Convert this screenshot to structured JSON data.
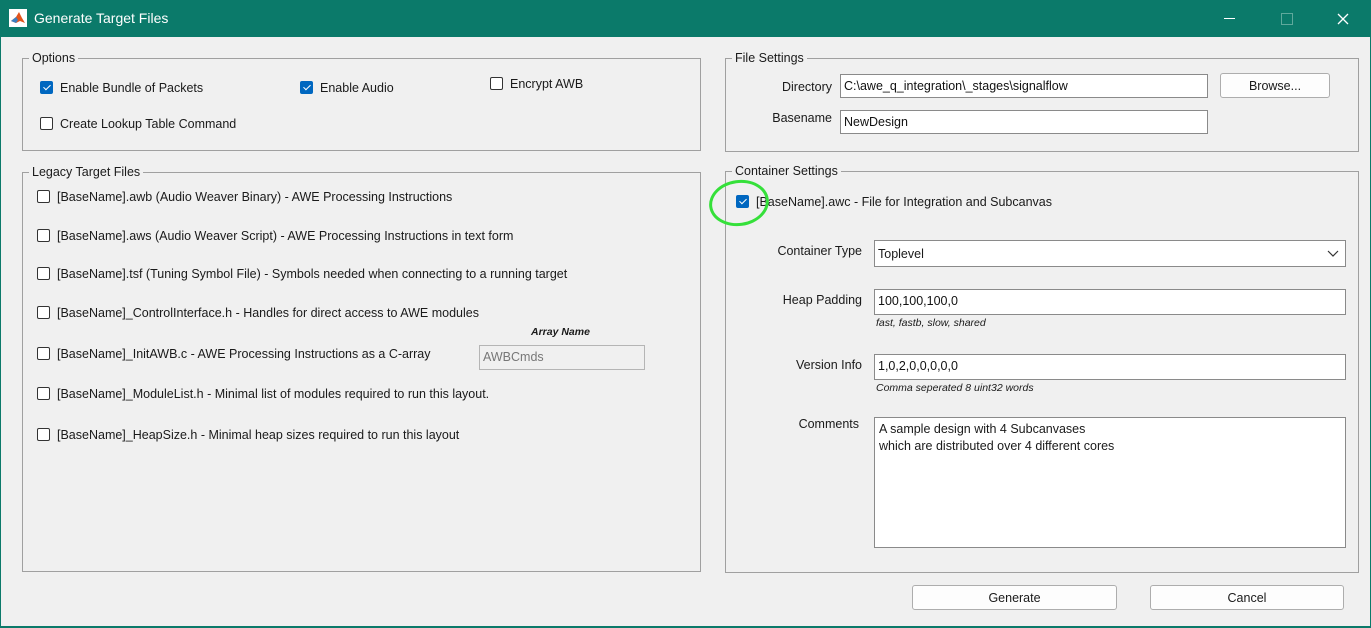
{
  "window": {
    "title": "Generate Target Files"
  },
  "options": {
    "legend": "Options",
    "enable_bundle": {
      "label": "Enable Bundle of Packets",
      "checked": true
    },
    "enable_audio": {
      "label": "Enable Audio",
      "checked": true
    },
    "encrypt_awb": {
      "label": "Encrypt AWB",
      "checked": false
    },
    "lookup_table": {
      "label": "Create Lookup Table Command",
      "checked": false
    }
  },
  "legacy": {
    "legend": "Legacy Target Files",
    "items": [
      {
        "label": "[BaseName].awb (Audio Weaver Binary) - AWE Processing Instructions",
        "checked": false
      },
      {
        "label": "[BaseName].aws (Audio Weaver Script) - AWE Processing Instructions in text form",
        "checked": false
      },
      {
        "label": "[BaseName].tsf (Tuning Symbol File) - Symbols needed when connecting to a running target",
        "checked": false
      },
      {
        "label": "[BaseName]_ControlInterface.h - Handles for direct access to AWE modules",
        "checked": false
      },
      {
        "label": "[BaseName]_InitAWB.c - AWE Processing Instructions as a C-array",
        "checked": false
      },
      {
        "label": "[BaseName]_ModuleList.h - Minimal list of modules required to run this layout.",
        "checked": false
      },
      {
        "label": "[BaseName]_HeapSize.h - Minimal heap sizes required to run this layout",
        "checked": false
      }
    ],
    "array_name_label": "Array Name",
    "array_name_value": "AWBCmds"
  },
  "file_settings": {
    "legend": "File Settings",
    "directory_label": "Directory",
    "directory_value": "C:\\awe_q_integration\\_stages\\signalflow",
    "browse_label": "Browse...",
    "basename_label": "Basename",
    "basename_value": "NewDesign"
  },
  "container": {
    "legend": "Container Settings",
    "awc": {
      "label": "[BaseName].awc - File for Integration and Subcanvas",
      "checked": true
    },
    "type_label": "Container Type",
    "type_value": "Toplevel",
    "heap_label": "Heap Padding",
    "heap_value": "100,100,100,0",
    "heap_hint": "fast, fastb, slow, shared",
    "version_label": "Version Info",
    "version_value": "1,0,2,0,0,0,0,0",
    "version_hint": "Comma seperated 8 uint32 words",
    "comments_label": "Comments",
    "comments_value": "A sample design with 4 Subcanvases\nwhich are distributed over 4 different cores"
  },
  "buttons": {
    "generate": "Generate",
    "cancel": "Cancel"
  },
  "colors": {
    "titlebar": "#0b7a6a",
    "checkbox": "#0067c0",
    "annotation": "#35e03a"
  }
}
